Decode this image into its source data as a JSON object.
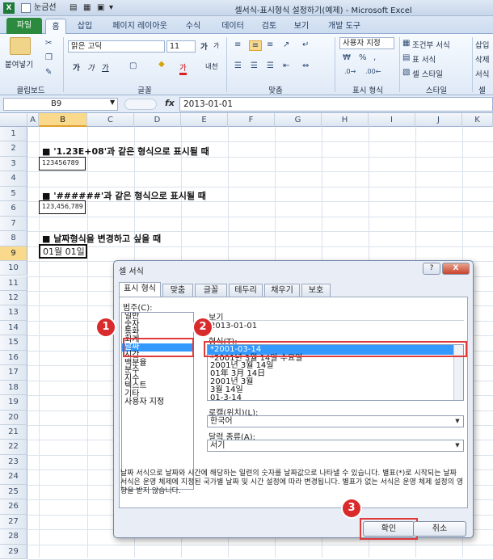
{
  "window": {
    "title": "셀서식-표시형식 설정하기(예제) - Microsoft Excel"
  },
  "quick_access": {
    "checkbox_label": "눈금선"
  },
  "ribbon_tabs": [
    "파일",
    "홈",
    "삽입",
    "페이지 레이아웃",
    "수식",
    "데이터",
    "검토",
    "보기",
    "개발 도구"
  ],
  "ribbon": {
    "clipboard": {
      "paste": "붙여넣기",
      "group": "클립보드"
    },
    "font": {
      "name": "맑은 고딕",
      "size": "11",
      "group": "글꼴",
      "bold": "가",
      "italic": "가",
      "underline": "가",
      "grow": "가",
      "shrink": "가",
      "color_letter": "가",
      "phonetic": "내천"
    },
    "alignment": {
      "group": "맞춤"
    },
    "number": {
      "format": "사용자 지정",
      "group": "표시 형식"
    },
    "styles": {
      "conditional": "조건부 서식",
      "table": "표 서식",
      "cell": "셀 스타일",
      "group": "스타일"
    },
    "cells": {
      "insert": "삽입",
      "delete": "삭제",
      "format": "서식",
      "group": "셀"
    }
  },
  "formula_bar": {
    "name_box": "B9",
    "fx": "fx",
    "value": "2013-01-01"
  },
  "columns": [
    "A",
    "B",
    "C",
    "D",
    "E",
    "F",
    "G",
    "H",
    "I",
    "J",
    "K"
  ],
  "rows": [
    "1",
    "2",
    "3",
    "4",
    "5",
    "6",
    "7",
    "8",
    "9",
    "10",
    "11",
    "12",
    "13",
    "14",
    "15",
    "16",
    "17",
    "18",
    "19",
    "20",
    "21",
    "22",
    "23",
    "24",
    "25",
    "26",
    "27",
    "28",
    "29"
  ],
  "sheet": {
    "h1": "■ '1.23E+08'과 같은 형식으로 표시될 때",
    "v1": "123456789",
    "h2": "■ '######'과 같은 형식으로 표시될 때",
    "v2": "123,456,789",
    "h3": "■ 날짜형식을 변경하고 싶을 때",
    "v3": "01월 01일"
  },
  "dialog": {
    "title": "셀 서식",
    "help": "?",
    "close": "X",
    "tabs": [
      "표시 형식",
      "맞춤",
      "글꼴",
      "테두리",
      "채우기",
      "보호"
    ],
    "category_label": "범주(C):",
    "categories": [
      "일반",
      "숫자",
      "통화",
      "회계",
      "날짜",
      "시간",
      "백분율",
      "분수",
      "지수",
      "텍스트",
      "기타",
      "사용자 지정"
    ],
    "preview_label": "보기",
    "preview_value": "2013-01-01",
    "type_label": "형식(T):",
    "types": [
      "*2001-03-14",
      "*2001년 3월 14일 수요일",
      "2001년 3월 14일",
      "01年 3月 14日",
      "2001년 3월",
      "3월 14일",
      "01-3-14"
    ],
    "locale_label": "로캘(위치)(L):",
    "locale_value": "한국어",
    "calendar_label": "달력 종류(A):",
    "calendar_value": "서기",
    "description": "날짜 서식으로 날짜와 시간에 해당하는 일련의 숫자를 날짜값으로 나타낼 수 있습니다. 별표(*)로 시작되는 날짜 서식은 운영 체제에 지정된 국가별 날짜 및 시간 설정에 따라 변경됩니다. 별표가 없는 서식은 운영 체제 설정의 영향을 받지 않습니다.",
    "ok": "확인",
    "cancel": "취소"
  },
  "badges": [
    "1",
    "2",
    "3"
  ],
  "colors": {
    "file_tab": "#2b8a3e",
    "selection": "#3399ff",
    "highlight_box": "#e03b3b",
    "badge": "#d92b2b"
  }
}
